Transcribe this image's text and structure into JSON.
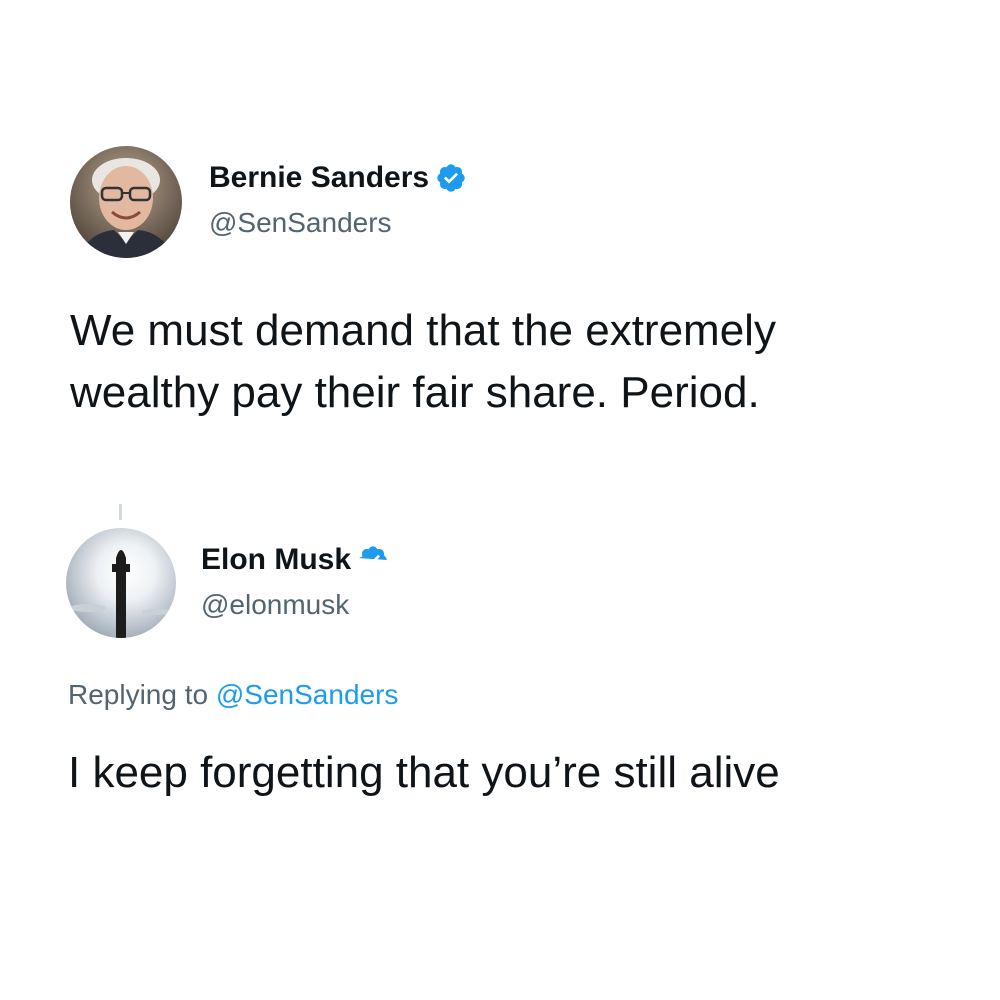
{
  "tweets": [
    {
      "display_name": "Bernie Sanders",
      "handle": "@SenSanders",
      "verified": true,
      "avatar": "bernie-sanders-photo",
      "text_lines": [
        "We must demand that the extremely",
        "wealthy pay their fair share. Period."
      ]
    },
    {
      "display_name": "Elon Musk",
      "handle": "@elonmusk",
      "verified": true,
      "avatar": "starship-photo",
      "reply_prefix": "Replying to",
      "reply_mention": "@SenSanders",
      "text_lines": [
        "I keep forgetting that you’re still alive"
      ]
    }
  ],
  "colors": {
    "verified_badge": "#1d9bf0",
    "mention": "#1d9bf0",
    "secondary_text": "#536471",
    "primary_text": "#0f1419"
  },
  "icons": [
    "verified-badge-icon"
  ]
}
